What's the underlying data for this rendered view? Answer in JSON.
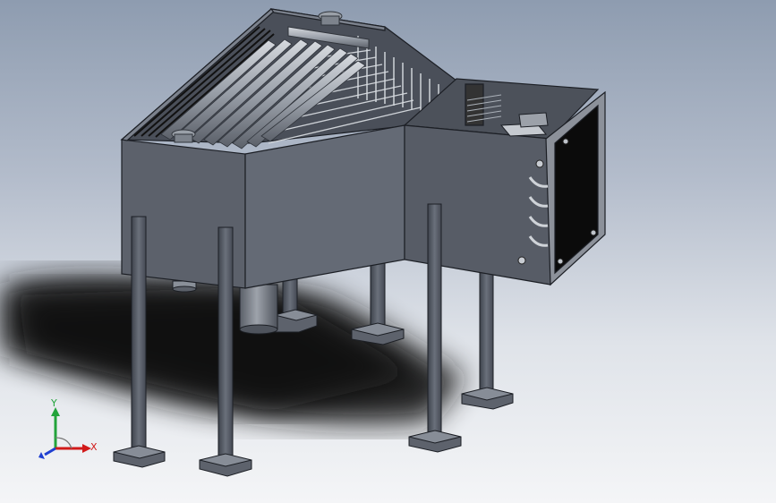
{
  "viewport": {
    "background_top": "#8e9cb0",
    "background_bottom": "#f4f5f7"
  },
  "model": {
    "body_color": "#5e6472",
    "tube_color": "#aeb3bb",
    "edge_color": "#1c1f25",
    "vent_color": "#111111",
    "support_legs": 8
  },
  "triad": {
    "x_label": "X",
    "y_label": "Y",
    "x_color": "#d11a1a",
    "y_color": "#22a33a",
    "z_color": "#1f3fd1"
  }
}
